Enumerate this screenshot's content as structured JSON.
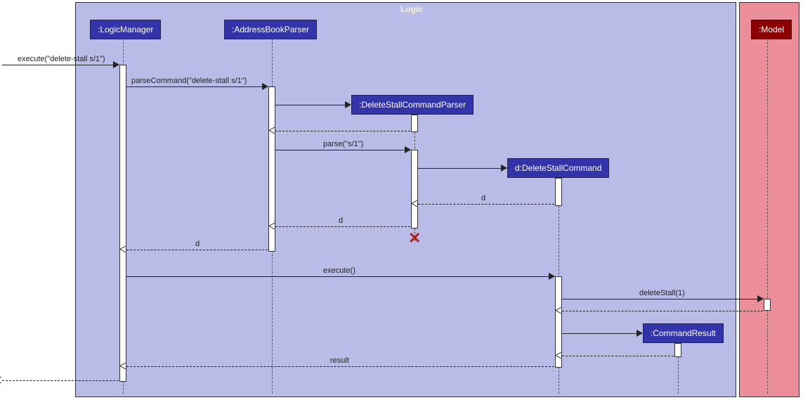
{
  "frames": {
    "logic": "Logic",
    "model": ""
  },
  "participants": {
    "logicManager": ":LogicManager",
    "addressBookParser": ":AddressBookParser",
    "deleteStallCommandParser": ":DeleteStallCommandParser",
    "deleteStallCommand": "d:DeleteStallCommand",
    "commandResult": ":CommandResult",
    "model": ":Model"
  },
  "messages": {
    "execute_in": "execute(\"delete-stall s/1\")",
    "parseCommand": "parseCommand(\"delete-stall s/1\")",
    "parse": "parse(\"s/1\")",
    "d_return1": "d",
    "d_return2": "d",
    "d_return3": "d",
    "execute_call": "execute()",
    "deleteStall": "deleteStall(1)",
    "result": "result"
  }
}
